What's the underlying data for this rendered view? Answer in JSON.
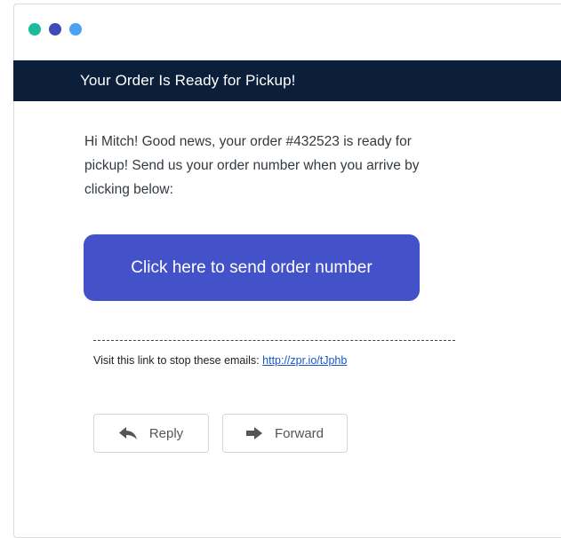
{
  "window": {
    "dots": [
      {
        "name": "dot-green",
        "color": "#1abc9c"
      },
      {
        "name": "dot-indigo",
        "color": "#3f4bb8"
      },
      {
        "name": "dot-blue",
        "color": "#4aa3f0"
      }
    ]
  },
  "email": {
    "banner_title": "Your Order Is Ready for Pickup!",
    "body": "Hi Mitch! Good news, your order #432523 is ready for pickup! Send us your order number when you arrive by clicking below:",
    "cta_label": "Click here to send order number",
    "divider": "--------------------------------------------------------------------------------",
    "unsubscribe_text": "Visit this link to stop these emails: ",
    "unsubscribe_link": "http://zpr.io/tJphb"
  },
  "actions": {
    "reply_label": "Reply",
    "forward_label": "Forward",
    "reply_icon": "reply-arrow-icon",
    "forward_icon": "forward-arrow-icon"
  },
  "colors": {
    "banner_bg": "#0b1f3a",
    "cta_bg": "#4452c9",
    "link": "#1a56c9"
  }
}
